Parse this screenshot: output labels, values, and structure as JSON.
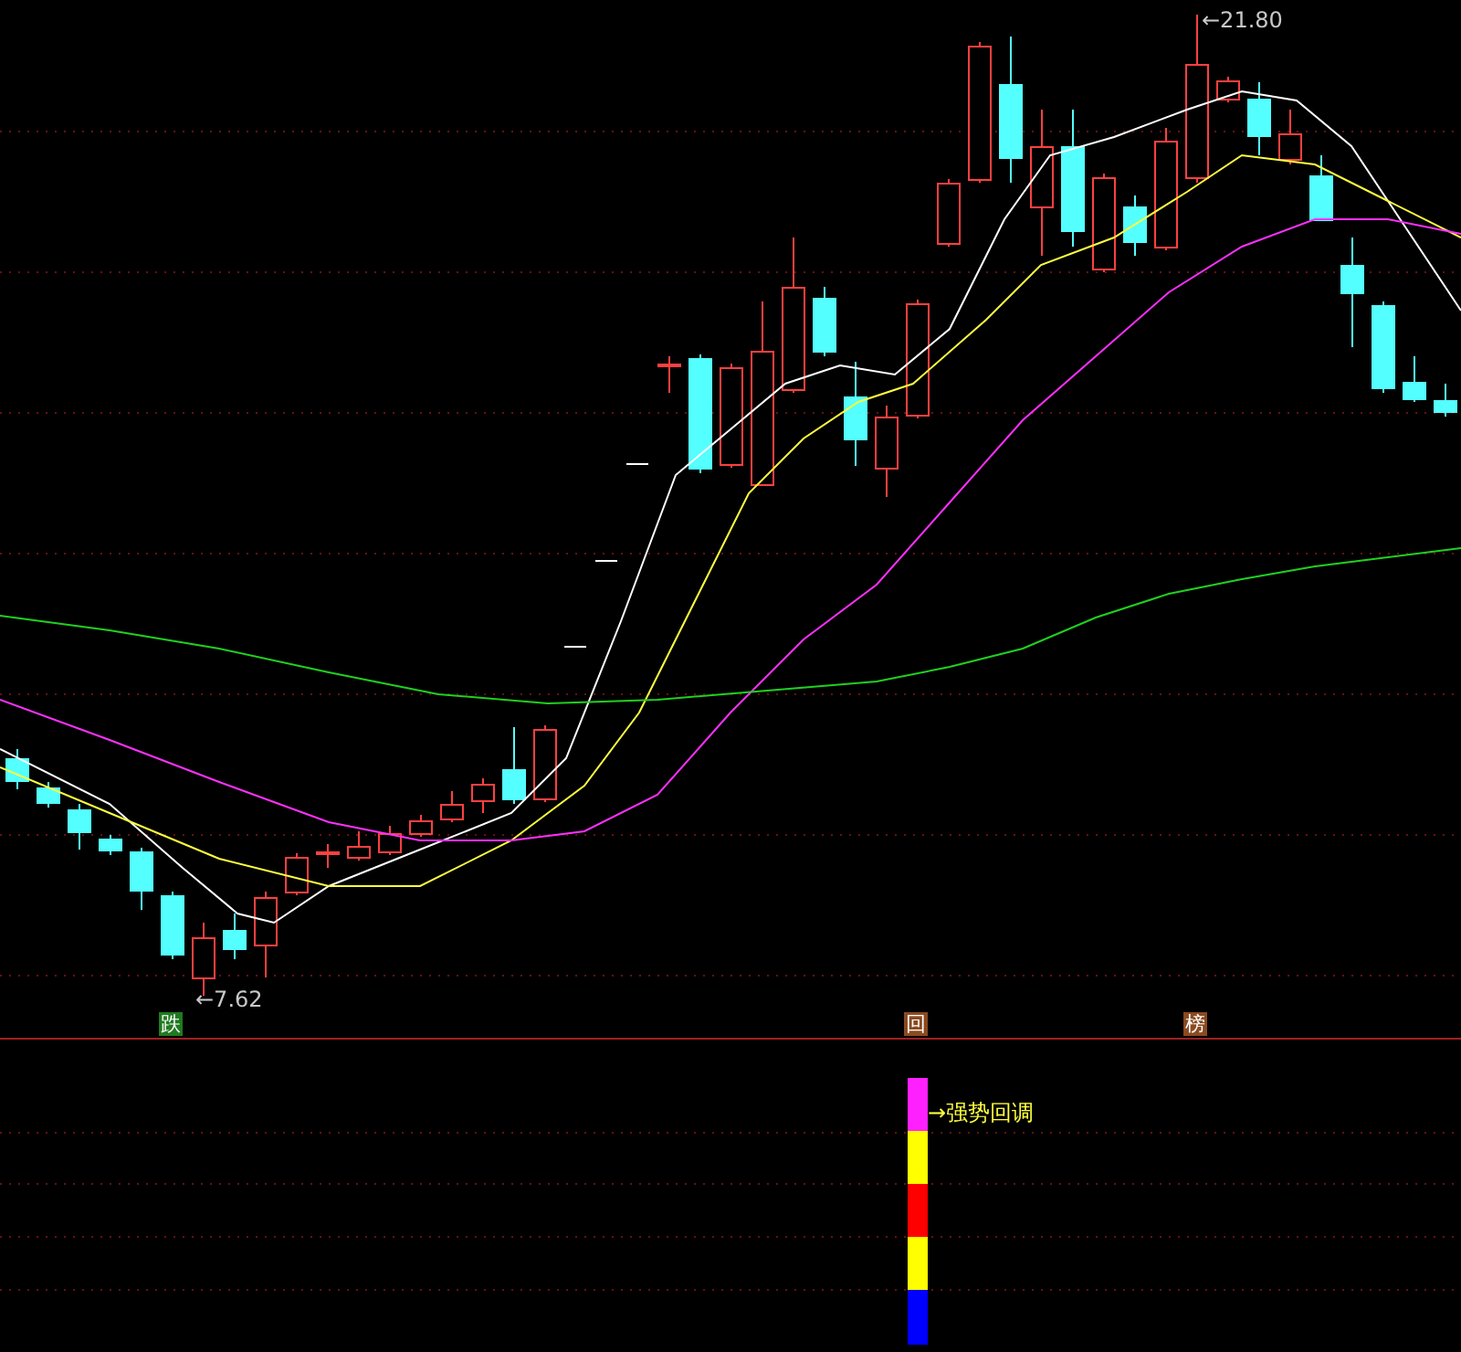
{
  "price_labels": [
    {
      "kind": "high",
      "text": "←21.80"
    },
    {
      "kind": "low",
      "text": "←7.62"
    }
  ],
  "signals": [
    {
      "text": "跌",
      "color": "#207a20"
    },
    {
      "text": "回",
      "color": "#8a4a20"
    },
    {
      "text": "榜",
      "color": "#8a4a20"
    }
  ],
  "indicator": {
    "label": "→强势回调",
    "segments": [
      {
        "color": "#ff20ff"
      },
      {
        "color": "#ffff00"
      },
      {
        "color": "#ff0000"
      },
      {
        "color": "#ffff00"
      },
      {
        "color": "#0000ff"
      }
    ]
  }
}
